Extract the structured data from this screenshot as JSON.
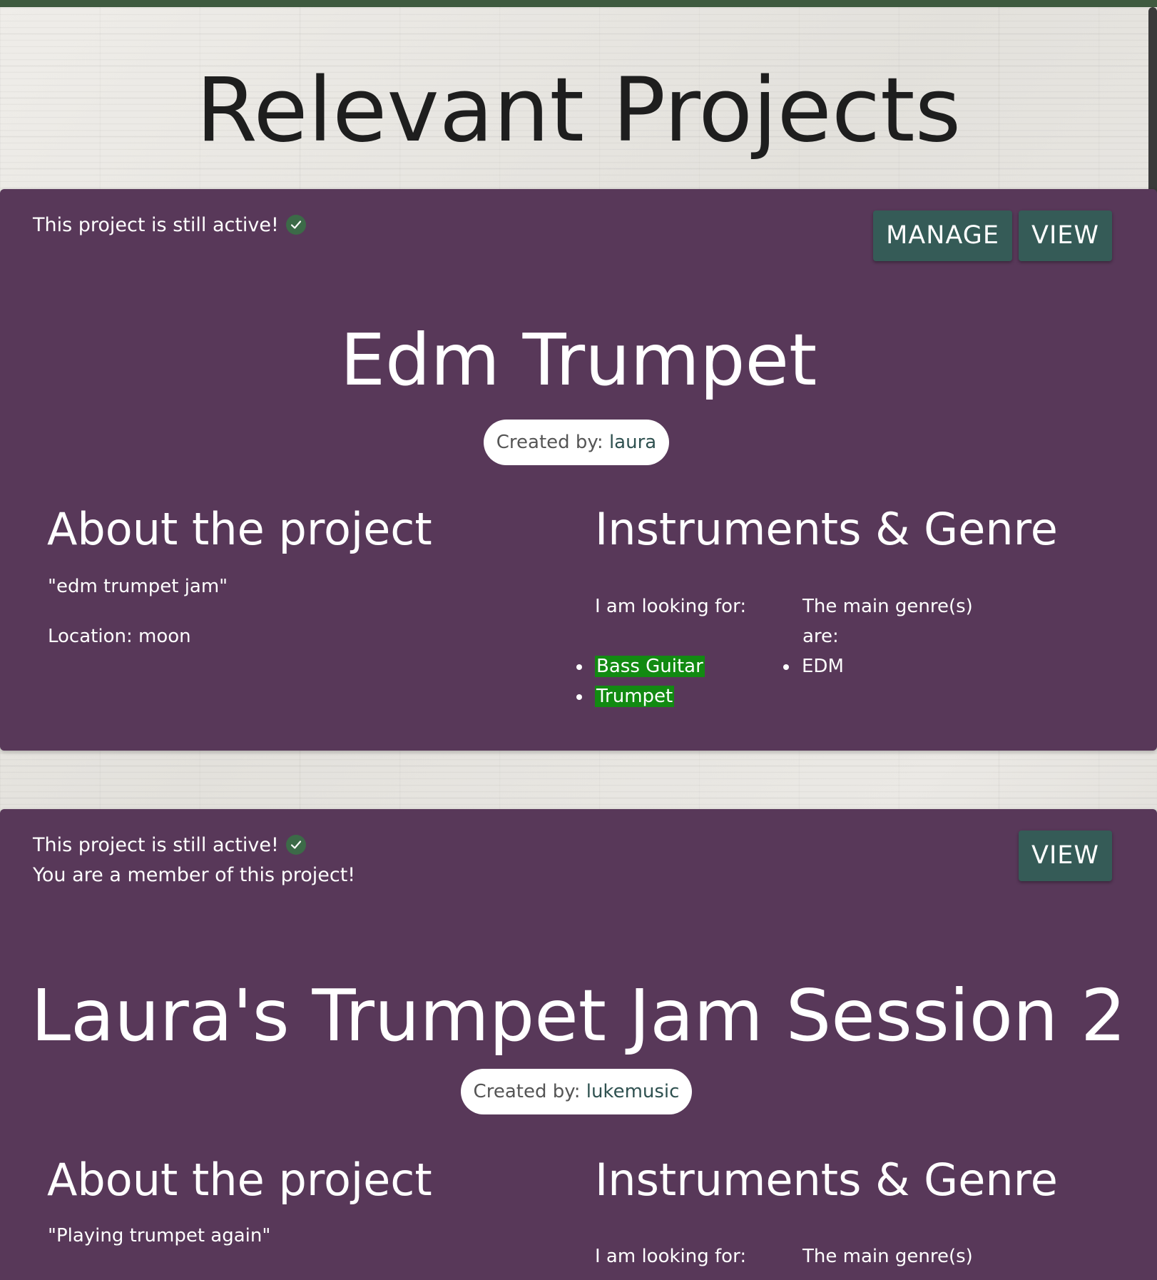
{
  "page": {
    "title": "Relevant Projects"
  },
  "projects": [
    {
      "status": "This project is still active!",
      "member_note": "",
      "buttons": {
        "manage": "MANAGE",
        "view": "VIEW"
      },
      "title": "Edm Trumpet",
      "created_by_label": "Created by:",
      "creator": "laura",
      "about_heading": "About the project",
      "description": "\"edm trumpet jam\"",
      "location": "Location: moon",
      "instruments_heading": "Instruments & Genre",
      "looking_for_label": "I am looking for:",
      "instruments": [
        "Bass Guitar",
        "Trumpet"
      ],
      "genre_label": "The main genre(s) are:",
      "genres": [
        "EDM"
      ]
    },
    {
      "status": "This project is still active!",
      "member_note": "You are a member of this project!",
      "buttons": {
        "view": "VIEW"
      },
      "title": "Laura's Trumpet Jam Session 2",
      "created_by_label": "Created by:",
      "creator": "lukemusic",
      "about_heading": "About the project",
      "description": "\"Playing trumpet again\"",
      "instruments_heading": "Instruments & Genre",
      "looking_for_label": "I am looking for:",
      "genre_label": "The main genre(s)"
    }
  ],
  "colors": {
    "card_bg": "#583859",
    "button_bg": "#355b57",
    "highlight": "#128a12",
    "topbar": "#3e5a3f"
  }
}
